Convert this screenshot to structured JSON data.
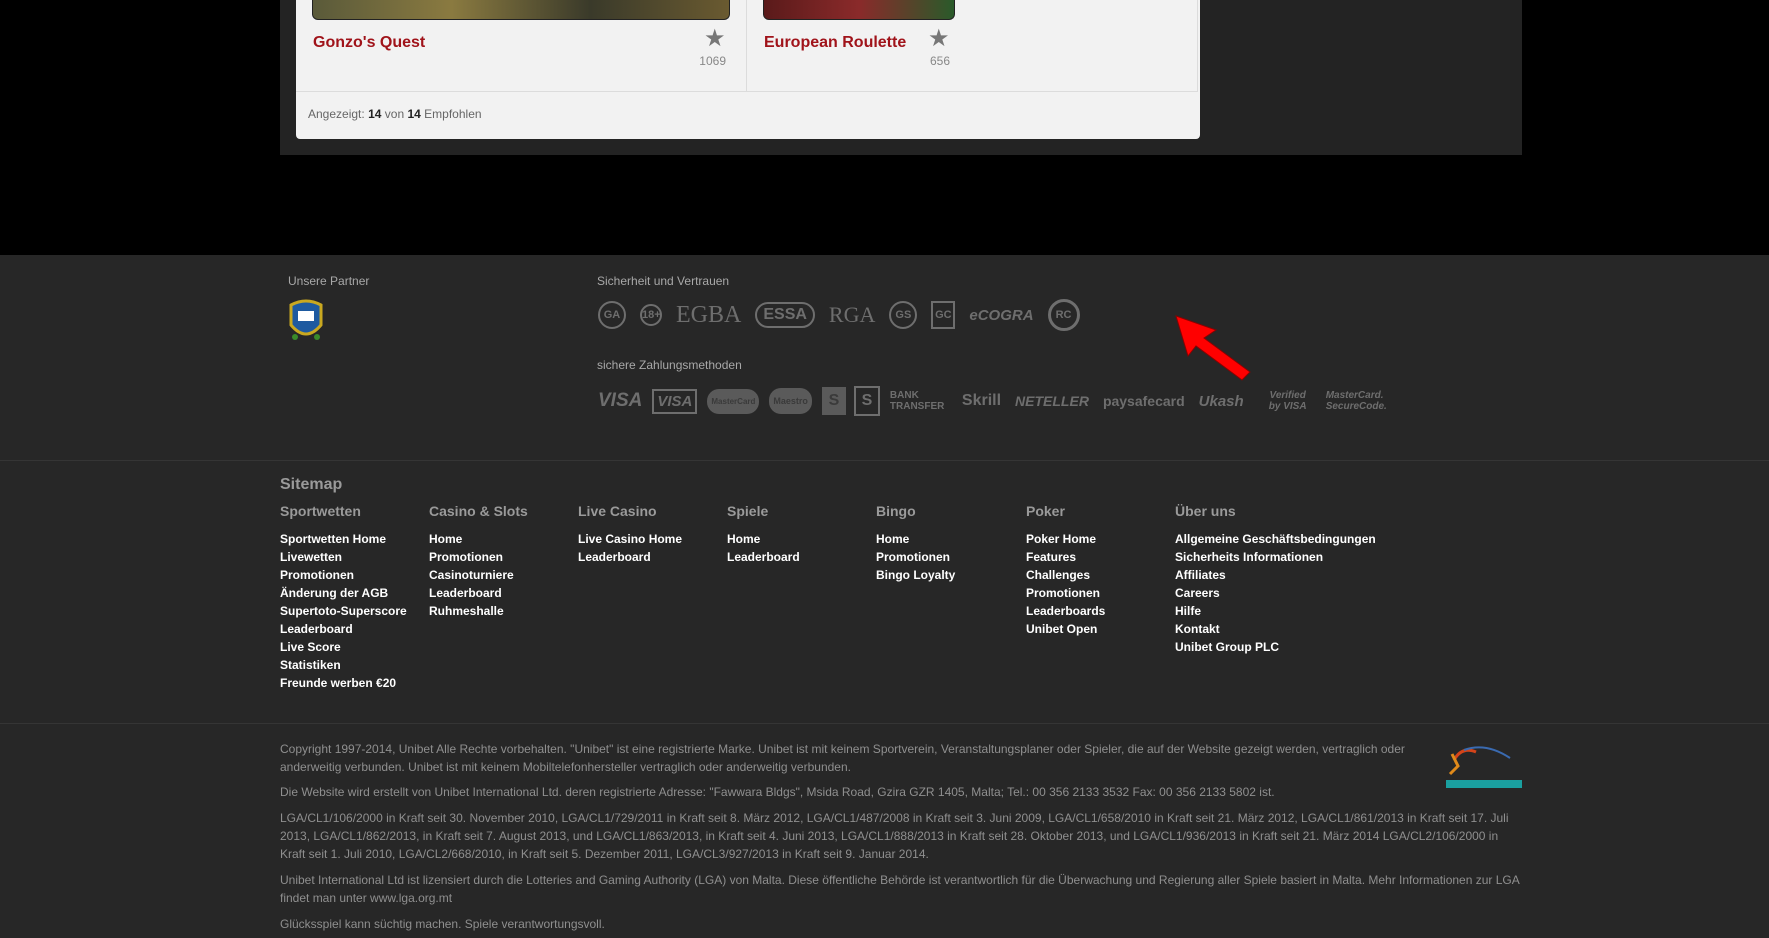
{
  "games": {
    "items": [
      {
        "title": "Gonzo's Quest",
        "count": "1069"
      },
      {
        "title": "European Roulette",
        "count": "656"
      }
    ],
    "summary": {
      "prefix": "Angezeigt:",
      "shown": "14",
      "mid": "von",
      "total": "14",
      "suffix": "Empfohlen"
    }
  },
  "footer": {
    "partners_label": "Unsere Partner",
    "security_label": "Sicherheit und Vertrauen",
    "security_logos": [
      "GA",
      "18+",
      "EGBA",
      "ESSA",
      "RGA",
      "GS",
      "GC",
      "eCOGRA",
      "RC"
    ],
    "payment_label": "sichere Zahlungsmethoden",
    "payment_logos": [
      "VISA",
      "VISA",
      "MasterCard",
      "Maestro",
      "S",
      "S",
      "BANK TRANSFER",
      "Skrill",
      "NETELLER",
      "paysafecard",
      "Ukash",
      "Verified by VISA",
      "MasterCard. SecureCode."
    ]
  },
  "sitemap": {
    "title": "Sitemap",
    "columns": [
      {
        "heading": "Sportwetten",
        "links": [
          "Sportwetten Home",
          "Livewetten",
          "Promotionen",
          "Änderung der AGB",
          "Supertoto-Superscore",
          "Leaderboard",
          "Live Score",
          "Statistiken",
          "Freunde werben €20"
        ]
      },
      {
        "heading": "Casino & Slots",
        "links": [
          "Home",
          "Promotionen",
          "Casinoturniere",
          "Leaderboard",
          "Ruhmeshalle"
        ]
      },
      {
        "heading": "Live Casino",
        "links": [
          "Live Casino Home",
          "Leaderboard"
        ]
      },
      {
        "heading": "Spiele",
        "links": [
          "Home",
          "Leaderboard"
        ]
      },
      {
        "heading": "Bingo",
        "links": [
          "Home",
          "Promotionen",
          "Bingo Loyalty"
        ]
      },
      {
        "heading": "Poker",
        "links": [
          "Poker Home",
          "Features",
          "Challenges",
          "Promotionen",
          "Leaderboards",
          "Unibet Open"
        ]
      },
      {
        "heading": "Über uns",
        "links": [
          "Allgemeine Geschäftsbedingungen",
          "Sicherheits Informationen",
          "Affiliates",
          "Careers",
          "Hilfe",
          "Kontakt",
          "Unibet Group PLC"
        ]
      }
    ]
  },
  "legal": [
    "Copyright 1997-2014, Unibet Alle Rechte vorbehalten. \"Unibet\" ist eine registrierte Marke. Unibet ist mit keinem Sportverein, Veranstaltungsplaner oder Spieler, die auf der Website gezeigt werden, vertraglich oder anderweitig verbunden. Unibet ist mit keinem Mobiltelefonhersteller vertraglich oder anderweitig verbunden.",
    "Die Website wird erstellt von Unibet International Ltd. deren registrierte Adresse: \"Fawwara Bldgs\", Msida Road, Gzira GZR 1405, Malta; Tel.: 00 356 2133 3532 Fax: 00 356 2133 5802 ist.",
    "LGA/CL1/106/2000 in Kraft seit 30. November 2010, LGA/CL1/729/2011 in Kraft seit 8. März 2012, LGA/CL1/487/2008 in Kraft seit 3. Juni 2009, LGA/CL1/658/2010 in Kraft seit 21. März 2012, LGA/CL1/861/2013 in Kraft seit 17. Juli 2013, LGA/CL1/862/2013, in Kraft seit 7. August 2013, und LGA/CL1/863/2013, in Kraft seit 4. Juni 2013, LGA/CL1/888/2013 in Kraft seit 28. Oktober 2013, und LGA/CL1/936/2013 in Kraft seit 21. März 2014 LGA/CL2/106/2000 in Kraft seit 1. Juli 2010, LGA/CL2/668/2010, in Kraft seit 5. Dezember 2011, LGA/CL3/927/2013 in Kraft seit 9. Januar 2014.",
    "Unibet International Ltd ist lizensiert durch die Lotteries and Gaming Authority (LGA) von Malta. Diese öffentliche Behörde ist verantwortlich für die Überwachung und Regierung aller Spiele basiert in Malta. Mehr Informationen zur LGA findet man unter www.lga.org.mt",
    "Glücksspiel kann süchtig machen. Spiele verantwortungsvoll."
  ],
  "colors": {
    "accent_red": "#a0131a",
    "arrow_red": "#ff0000",
    "footer_bg": "#272727"
  }
}
